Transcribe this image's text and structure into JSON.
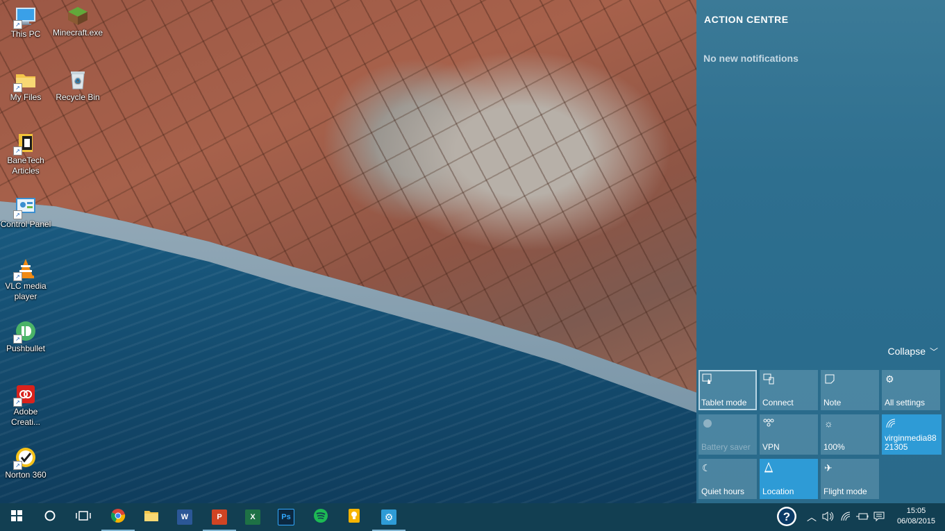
{
  "desktop": {
    "icons": [
      {
        "label": "This PC",
        "icon": "computer-icon"
      },
      {
        "label": "Minecraft.exe",
        "icon": "minecraft-icon"
      },
      {
        "label": "My Files",
        "icon": "folder-icon"
      },
      {
        "label": "Recycle Bin",
        "icon": "recycle-bin-icon"
      },
      {
        "label": "BaneTech Articles",
        "icon": "document-icon"
      },
      {
        "label": "Control Panel",
        "icon": "control-panel-icon"
      },
      {
        "label": "VLC media player",
        "icon": "vlc-icon"
      },
      {
        "label": "Pushbullet",
        "icon": "pushbullet-icon"
      },
      {
        "label": "Adobe Creati...",
        "icon": "adobe-icon"
      },
      {
        "label": "Norton 360",
        "icon": "norton-icon"
      }
    ]
  },
  "action_centre": {
    "title": "ACTION CENTRE",
    "empty_text": "No new notifications",
    "collapse_label": "Collapse",
    "tiles": [
      {
        "label": "Tablet mode",
        "icon": "tablet-icon",
        "state": "selected"
      },
      {
        "label": "Connect",
        "icon": "connect-icon",
        "state": "off"
      },
      {
        "label": "Note",
        "icon": "note-icon",
        "state": "off"
      },
      {
        "label": "All settings",
        "icon": "gear-icon",
        "state": "off"
      },
      {
        "label": "Battery saver",
        "icon": "battery-saver-icon",
        "state": "disabled"
      },
      {
        "label": "VPN",
        "icon": "vpn-icon",
        "state": "off"
      },
      {
        "label": "100%",
        "icon": "brightness-icon",
        "state": "off"
      },
      {
        "label": "virginmedia8821305",
        "icon": "wifi-icon",
        "state": "on"
      },
      {
        "label": "Quiet hours",
        "icon": "moon-icon",
        "state": "off"
      },
      {
        "label": "Location",
        "icon": "location-icon",
        "state": "on"
      },
      {
        "label": "Flight mode",
        "icon": "airplane-icon",
        "state": "off"
      }
    ]
  },
  "taskbar": {
    "apps": [
      {
        "name": "Chrome",
        "icon": "chrome-icon"
      },
      {
        "name": "File Explorer",
        "icon": "folder-icon"
      },
      {
        "name": "Word",
        "icon": "word-icon",
        "text": "W"
      },
      {
        "name": "PowerPoint",
        "icon": "powerpoint-icon",
        "text": "P"
      },
      {
        "name": "Excel",
        "icon": "excel-icon",
        "text": "X"
      },
      {
        "name": "Photoshop",
        "icon": "photoshop-icon",
        "text": "Ps"
      },
      {
        "name": "Spotify",
        "icon": "spotify-icon"
      },
      {
        "name": "Keep",
        "icon": "keep-icon"
      },
      {
        "name": "Settings",
        "icon": "gear-icon"
      }
    ],
    "clock": {
      "time": "15:05",
      "date": "06/08/2015"
    }
  }
}
